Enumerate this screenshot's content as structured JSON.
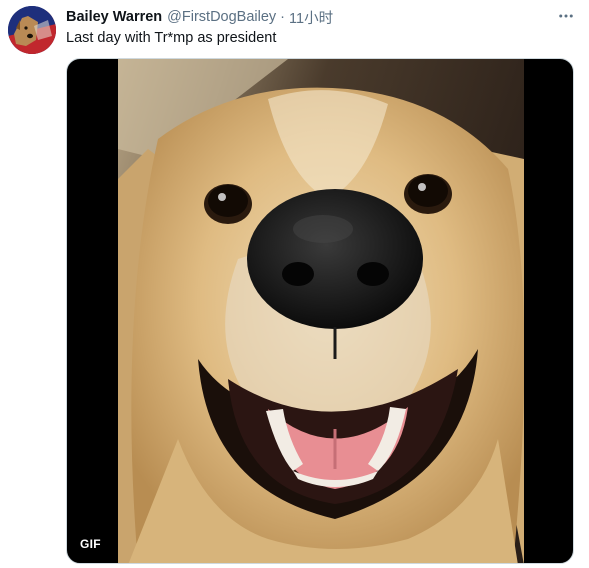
{
  "tweet": {
    "author": {
      "display_name": "Bailey Warren",
      "handle": "@FirstDogBailey",
      "avatar_icon": "dog-avatar"
    },
    "separator": "·",
    "timestamp": "11小时",
    "text": "Last day with Tr*mp as president",
    "media": {
      "type": "gif",
      "badge": "GIF",
      "subject": "golden-retriever-smiling"
    },
    "more_icon": "more-horizontal-icon"
  },
  "colors": {
    "text_primary": "#0f1419",
    "text_secondary": "#5b7083",
    "media_border": "#cfd9de",
    "media_background": "#000000"
  }
}
